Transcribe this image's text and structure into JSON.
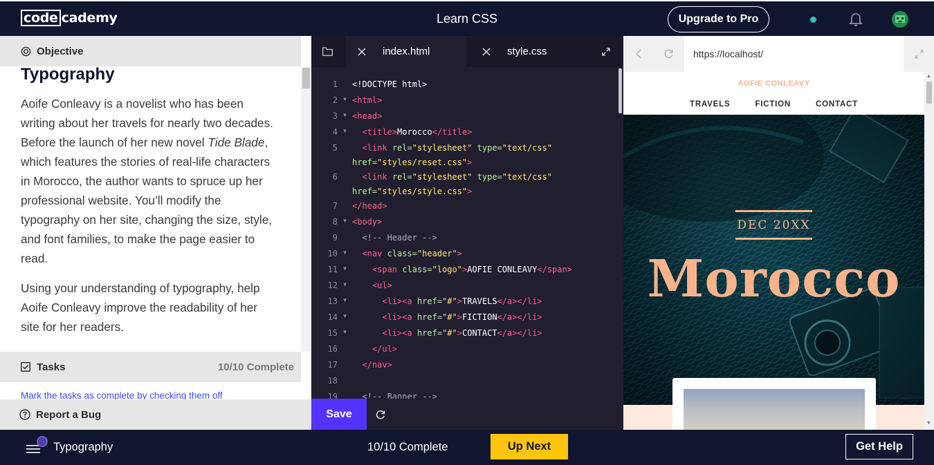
{
  "topbar": {
    "logo_box": "code",
    "logo_rest": "cademy",
    "title": "Learn CSS",
    "upgrade_label": "Upgrade to Pro"
  },
  "left": {
    "objective_label": "Objective",
    "lesson_title": "Typography",
    "para1_a": "Aoife Conleavy is a novelist who has been writing about her travels for nearly two decades. Before the launch of her new novel ",
    "para1_italic": "Tide Blade",
    "para1_b": ", which features the stories of real-life characters in Morocco, the author wants to spruce up her professional website. You’ll modify the typography on her site, changing the size, style, and font families, to make the page easier to read.",
    "para2": "Using your understanding of typography, help Aoife Conleavy improve the readability of her site for her readers.",
    "tasks_label": "Tasks",
    "tasks_count": "10/10 Complete",
    "tasks_hint": "Mark the tasks as complete by checking them off",
    "bug_label": "Report a Bug"
  },
  "editor": {
    "tabs": [
      {
        "label": "index.html",
        "active": true
      },
      {
        "label": "style.css",
        "active": false
      }
    ],
    "save_label": "Save",
    "lines": [
      {
        "n": "1",
        "fold": "",
        "html": "&lt;!DOCTYPE html&gt;"
      },
      {
        "n": "2",
        "fold": "▼",
        "html": "<span class='tag'>&lt;html&gt;</span>"
      },
      {
        "n": "3",
        "fold": "▼",
        "html": "<span class='tag'>&lt;head&gt;</span>"
      },
      {
        "n": "4",
        "fold": "▼",
        "html": "  <span class='tag'>&lt;title&gt;</span>Morocco<span class='tag'>&lt;/title&gt;</span>"
      },
      {
        "n": "5",
        "fold": "",
        "html": "  <span class='tag'>&lt;link</span> <span class='attr'>rel=</span><span class='str'>\"stylesheet\"</span> <span class='attr'>type=</span><span class='str'>\"text/css\"</span>\n<span class='attr'>href=</span><span class='str'>\"styles/reset.css\"</span><span class='tag'>&gt;</span>"
      },
      {
        "n": "6",
        "fold": "",
        "html": "  <span class='tag'>&lt;link</span> <span class='attr'>rel=</span><span class='str'>\"stylesheet\"</span> <span class='attr'>type=</span><span class='str'>\"text/css\"</span>\n<span class='attr'>href=</span><span class='str'>\"styles/style.css\"</span><span class='tag'>&gt;</span>"
      },
      {
        "n": "7",
        "fold": "",
        "html": "<span class='tag'>&lt;/head&gt;</span>"
      },
      {
        "n": "8",
        "fold": "▼",
        "html": "<span class='tag'>&lt;body&gt;</span>"
      },
      {
        "n": "9",
        "fold": "",
        "html": "  <span class='cmt'>&lt;!-- Header --&gt;</span>"
      },
      {
        "n": "10",
        "fold": "▼",
        "html": "  <span class='tag'>&lt;nav</span> <span class='attr'>class=</span><span class='str'>\"header\"</span><span class='tag'>&gt;</span>"
      },
      {
        "n": "11",
        "fold": "▼",
        "html": "    <span class='tag'>&lt;span</span> <span class='attr'>class=</span><span class='str'>\"logo\"</span><span class='tag'>&gt;</span>AOFIE CONLEAVY<span class='tag'>&lt;/span&gt;</span>"
      },
      {
        "n": "12",
        "fold": "▼",
        "html": "    <span class='tag'>&lt;ul&gt;</span>"
      },
      {
        "n": "13",
        "fold": "▼",
        "html": "      <span class='tag'>&lt;li&gt;&lt;a</span> <span class='attr'>href=</span><span class='str'>\"#\"</span><span class='tag'>&gt;</span>TRAVELS<span class='tag'>&lt;/a&gt;&lt;/li&gt;</span>"
      },
      {
        "n": "14",
        "fold": "▼",
        "html": "      <span class='tag'>&lt;li&gt;&lt;a</span> <span class='attr'>href=</span><span class='str'>\"#\"</span><span class='tag'>&gt;</span>FICTION<span class='tag'>&lt;/a&gt;&lt;/li&gt;</span>"
      },
      {
        "n": "15",
        "fold": "▼",
        "html": "      <span class='tag'>&lt;li&gt;&lt;a</span> <span class='attr'>href=</span><span class='str'>\"#\"</span><span class='tag'>&gt;</span>CONTACT<span class='tag'>&lt;/a&gt;&lt;/li&gt;</span>"
      },
      {
        "n": "16",
        "fold": "",
        "html": "    <span class='tag'>&lt;/ul&gt;</span>"
      },
      {
        "n": "17",
        "fold": "",
        "html": "  <span class='tag'>&lt;/nav&gt;</span>"
      },
      {
        "n": "18",
        "fold": "",
        "html": ""
      },
      {
        "n": "19",
        "fold": "",
        "html": "  <span class='cmt'>&lt;!-- Banner --&gt;</span>"
      }
    ]
  },
  "browser": {
    "url": "https://localhost/",
    "site_logo": "AOFIE CONLEAVY",
    "nav": [
      "TRAVELS",
      "FICTION",
      "CONTACT"
    ],
    "date": "DEC 20XX",
    "hero_title": "Morocco"
  },
  "bottombar": {
    "lesson": "Typography",
    "progress": "10/10 Complete",
    "upnext_label": "Up Next",
    "help_label": "Get Help"
  },
  "colors": {
    "navy": "#10162f",
    "editor_bg": "#211e2f",
    "save_purple": "#5533ff",
    "upnext_yellow": "#ffc40c",
    "peach": "#f7b38b",
    "tag_pink": "#ff5c8a",
    "attr_green": "#b6f09c",
    "string_yellow": "#ffe66d"
  },
  "icons": [
    "objective-target-icon",
    "checkbox-icon",
    "help-circle-icon",
    "folder-icon",
    "close-icon",
    "expand-icon",
    "refresh-icon",
    "back-arrow-icon",
    "reload-icon",
    "fullscreen-icon",
    "bell-icon",
    "avatar-icon",
    "hamburger-menu-icon"
  ]
}
